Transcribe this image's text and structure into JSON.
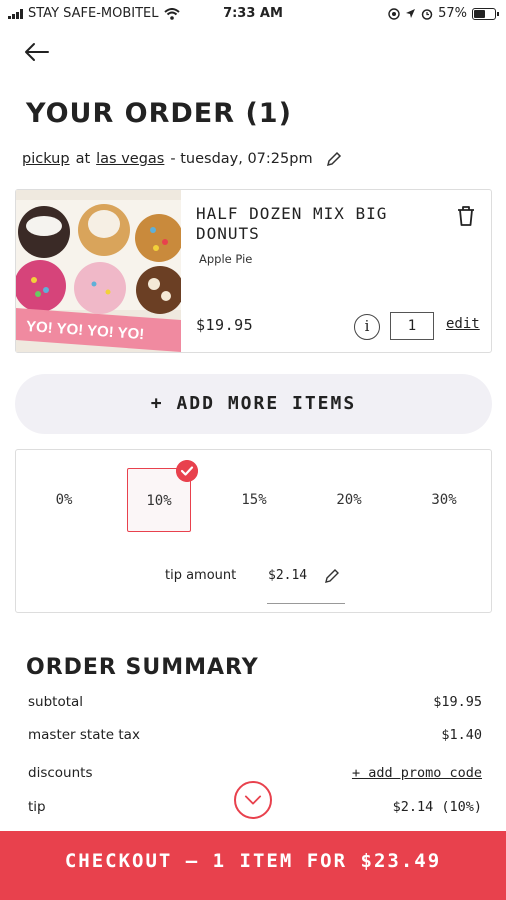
{
  "status_bar": {
    "carrier": "STAY SAFE-MOBITEL",
    "time": "7:33 AM",
    "battery_percent": "57%",
    "battery_level": 0.57
  },
  "header": {
    "title": "YOUR ORDER (1)"
  },
  "order_meta": {
    "mode": "pickup",
    "at": "at",
    "location": "las vegas",
    "time": "- tuesday, 07:25pm"
  },
  "item": {
    "name": "HALF DOZEN MIX BIG DONUTS",
    "flavor": "Apple Pie",
    "price": "$19.95",
    "info": "i",
    "quantity": "1",
    "edit_label": "edit",
    "image_text": "YO! YO! YO! YO!"
  },
  "add_more": {
    "label": "+ ADD MORE ITEMS"
  },
  "tip": {
    "options": [
      "0%",
      "10%",
      "15%",
      "20%",
      "30%"
    ],
    "selected": "10%",
    "amount_label": "tip amount",
    "amount_value": "$2.14"
  },
  "summary": {
    "title": "ORDER SUMMARY",
    "rows": [
      {
        "label": "subtotal",
        "value": "$19.95"
      },
      {
        "label": "master state tax",
        "value": "$1.40"
      },
      {
        "label": "discounts",
        "value": "+ add promo code"
      },
      {
        "label": "tip",
        "value": "$2.14 (10%)"
      }
    ]
  },
  "checkout": {
    "label": "CHECKOUT — 1 ITEM FOR $23.49"
  },
  "colors": {
    "accent": "#e8414d",
    "button_bg": "#f1f0f5",
    "text": "#222222"
  },
  "icons": [
    "back-arrow-icon",
    "pencil-icon",
    "trash-icon",
    "info-icon",
    "check-icon",
    "chevron-down-icon",
    "wifi-icon",
    "battery-icon"
  ]
}
